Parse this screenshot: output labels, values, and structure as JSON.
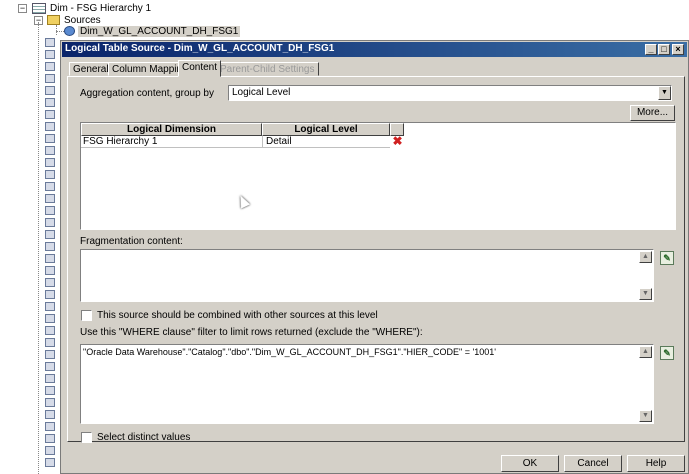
{
  "tree": {
    "dim_label": "Dim - FSG Hierarchy 1",
    "sources_label": "Sources",
    "source_label": "Dim_W_GL_ACCOUNT_DH_FSG1"
  },
  "dialog": {
    "title": "Logical Table Source - Dim_W_GL_ACCOUNT_DH_FSG1",
    "minimize": "_",
    "maximize": "□",
    "close": "×",
    "tabs": [
      {
        "label": "General"
      },
      {
        "label": "Column Mapping"
      },
      {
        "label": "Content"
      },
      {
        "label": "Parent-Child Settings"
      }
    ],
    "aggregation": {
      "label": "Aggregation content, group by",
      "value": "Logical Level",
      "more_label": "More..."
    },
    "grid": {
      "headers": [
        "Logical Dimension",
        "Logical Level"
      ],
      "rows": [
        {
          "dimension": "FSG Hierarchy 1",
          "level": "Detail"
        }
      ]
    },
    "fragmentation": {
      "label": "Fragmentation content:",
      "value": ""
    },
    "combine_checkbox_label": "This source should be combined with other sources at this level",
    "where": {
      "label": "Use this \"WHERE clause\" filter to limit rows returned (exclude the \"WHERE\"):",
      "value": "\"Oracle Data Warehouse\".\"Catalog\".\"dbo\".\"Dim_W_GL_ACCOUNT_DH_FSG1\".\"HIER_CODE\" = '1001'"
    },
    "distinct_checkbox_label": "Select distinct values",
    "buttons": {
      "ok": "OK",
      "cancel": "Cancel",
      "help": "Help"
    }
  }
}
